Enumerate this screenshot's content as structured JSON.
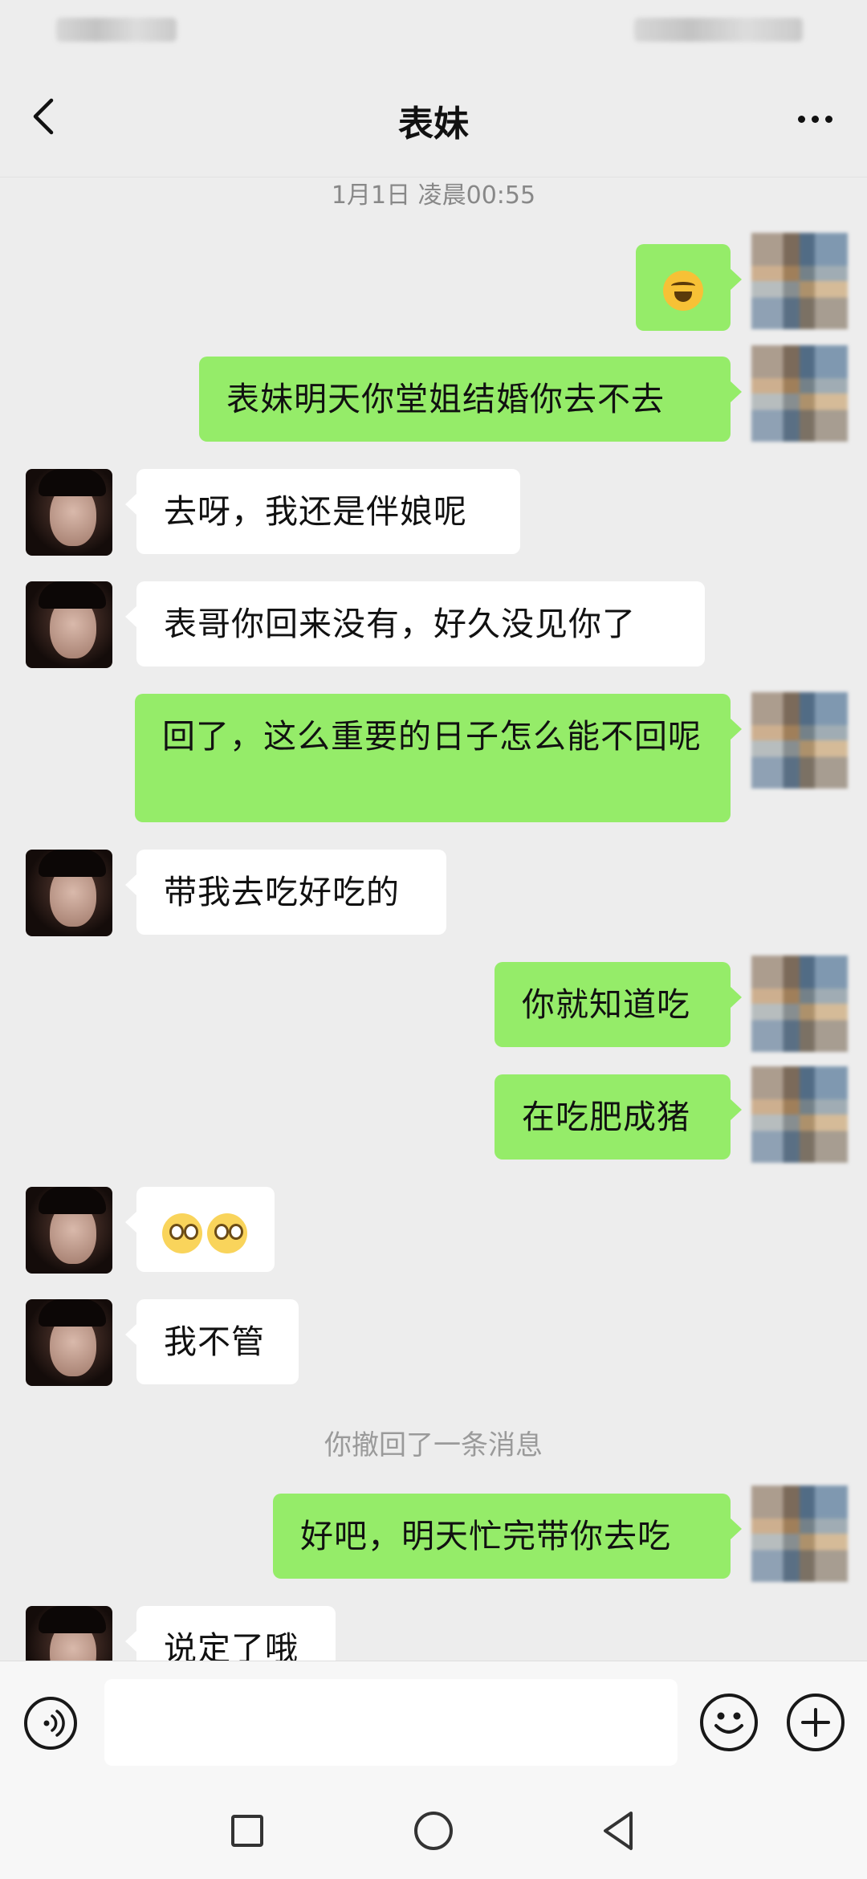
{
  "header": {
    "title": "表妹"
  },
  "chat": {
    "timestamp": "1月1日 凌晨00:55",
    "messages": [
      {
        "side": "out",
        "emoji": "laughing-crying-emoji"
      },
      {
        "side": "out",
        "text": "表妹明天你堂姐结婚你去不去"
      },
      {
        "side": "in",
        "text": "去呀，我还是伴娘呢"
      },
      {
        "side": "in",
        "text": "表哥你回来没有，好久没见你了"
      },
      {
        "side": "out",
        "text": "回了，这么重要的日子怎么能不回呢"
      },
      {
        "side": "in",
        "text": "带我去吃好吃的"
      },
      {
        "side": "out",
        "text": "你就知道吃"
      },
      {
        "side": "out",
        "text": "在吃肥成猪"
      },
      {
        "side": "in",
        "emoji": "pleading-face-emoji x2"
      },
      {
        "side": "in",
        "text": "我不管"
      },
      {
        "side": "out",
        "text": "好吧，明天忙完带你去吃"
      },
      {
        "side": "in",
        "text": "说定了哦"
      }
    ],
    "recall_notice": "你撤回了一条消息"
  },
  "input": {
    "placeholder": ""
  },
  "icons": {
    "back": "chevron-left-icon",
    "more": "more-dots-icon",
    "voice": "voice-icon",
    "emoji": "smiley-icon",
    "add": "plus-circle-icon"
  },
  "colors": {
    "background": "#EDEDED",
    "outgoing_bubble": "#95EC69",
    "incoming_bubble": "#FFFFFF"
  }
}
